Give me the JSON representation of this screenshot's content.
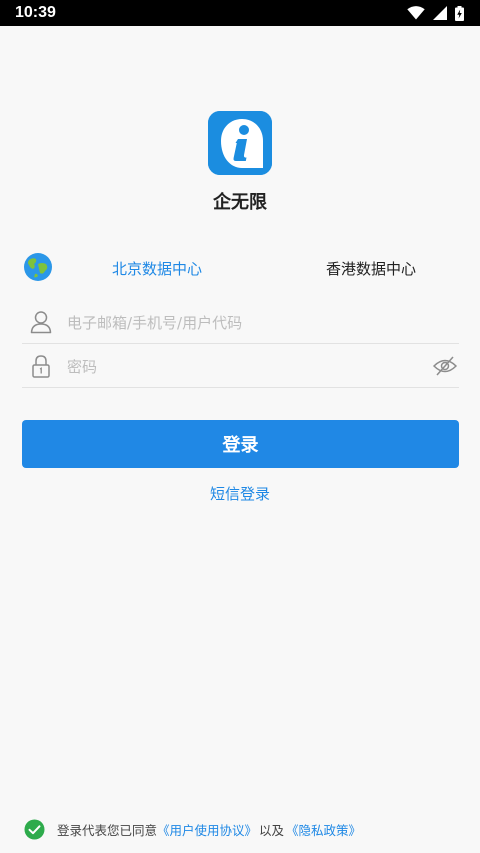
{
  "status_bar": {
    "time": "10:39"
  },
  "app": {
    "name": "企无限",
    "logo_color": "#1b8de0"
  },
  "data_centers": {
    "items": [
      {
        "label": "北京数据中心",
        "selected": true
      },
      {
        "label": "香港数据中心",
        "selected": false
      }
    ]
  },
  "form": {
    "username_placeholder": "电子邮箱/手机号/用户代码",
    "password_placeholder": "密码"
  },
  "login_button": {
    "label": "登录",
    "color": "#2088e5"
  },
  "sms_login": {
    "label": "短信登录"
  },
  "agreement": {
    "prefix": "登录代表您已同意",
    "user_agreement": "《用户使用协议》",
    "conjunction": "以及",
    "privacy_policy": "《隐私政策》",
    "checked": true
  },
  "icons": {
    "globe": "globe-icon",
    "user": "user-icon",
    "lock": "lock-icon",
    "eye": "eye-off-icon",
    "check": "check-circle-icon"
  }
}
